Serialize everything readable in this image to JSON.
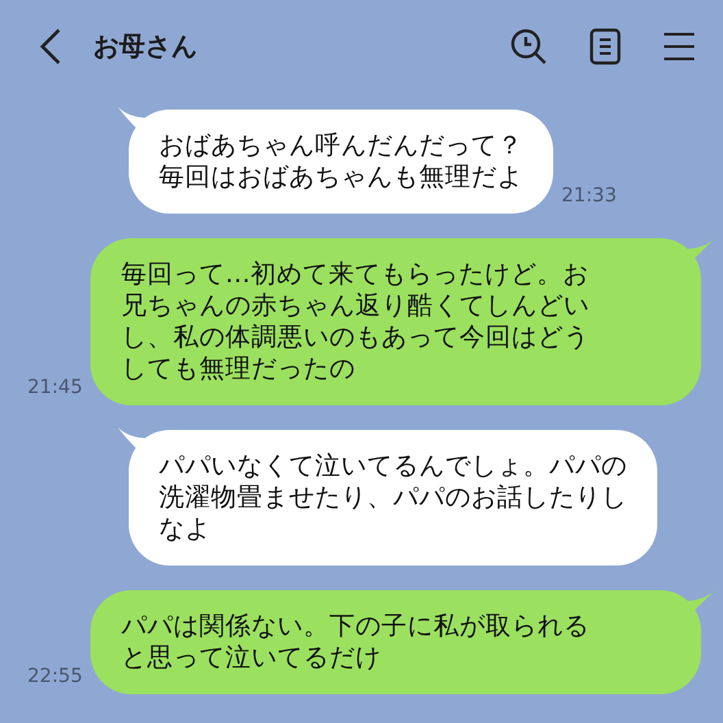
{
  "header": {
    "title": "お母さん"
  },
  "messages": [
    {
      "kind": "incoming",
      "lines": [
        "おばあちゃん呼んだんだって？",
        "毎回はおばあちゃんも無理だよ"
      ],
      "time": "21:33"
    },
    {
      "kind": "outgoing",
      "lines": [
        "毎回って…初めて来てもらったけど。お",
        "兄ちゃんの赤ちゃん返り酷くてしんどい",
        "し、私の体調悪いのもあって今回はどう",
        "しても無理だったの"
      ],
      "time": "21:45"
    },
    {
      "kind": "incoming",
      "lines": [
        "パパいなくて泣いてるんでしょ。パパの",
        "洗濯物畳ませたり、パパのお話したりし",
        "なよ"
      ]
    },
    {
      "kind": "outgoing",
      "lines": [
        "パパは関係ない。下の子に私が取られる",
        "と思って泣いてるだけ"
      ],
      "time": "22:55"
    }
  ]
}
